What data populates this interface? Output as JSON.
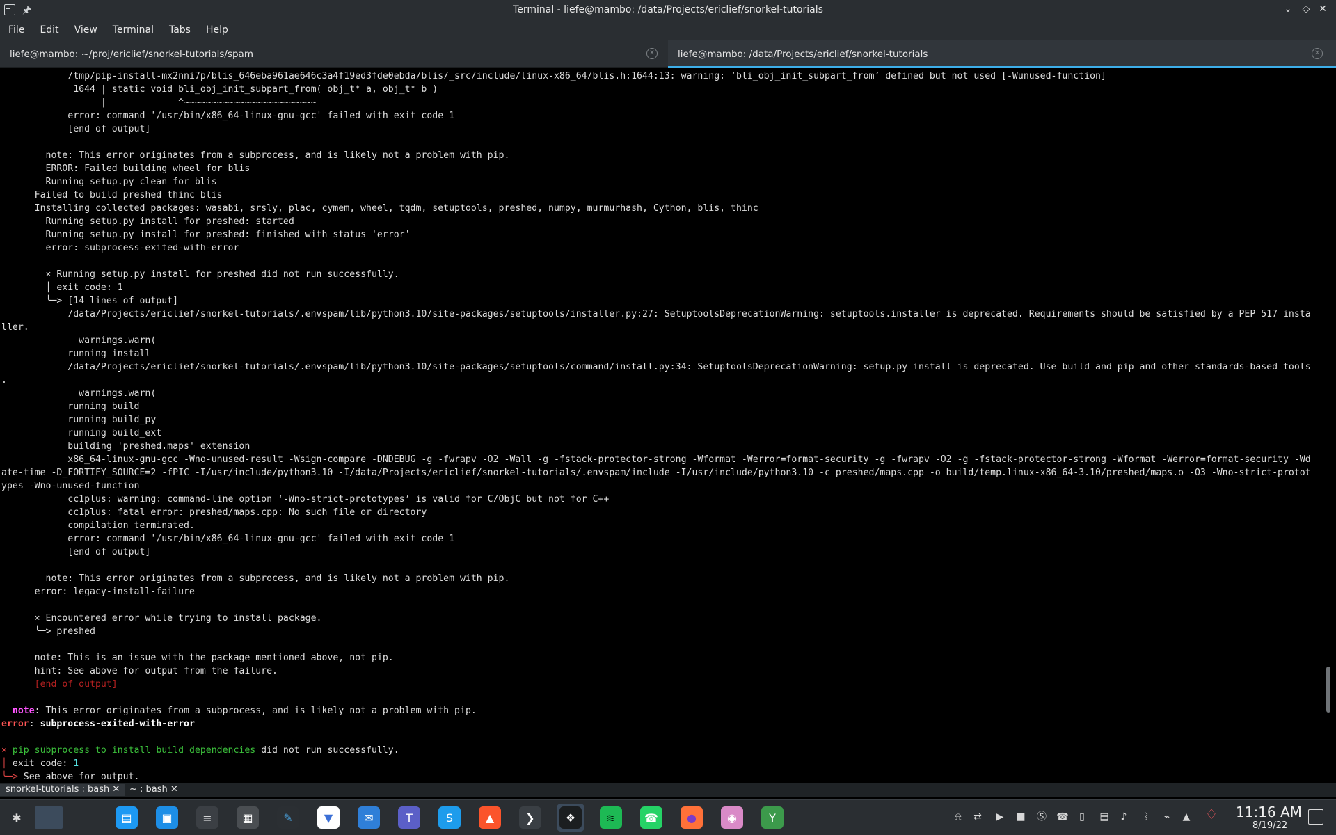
{
  "window": {
    "title": "Terminal - liefe@mambo: /data/Projects/ericlief/snorkel-tutorials",
    "controls": {
      "minimize": "⌄",
      "maximize": "◇",
      "close": "✕"
    }
  },
  "menu": [
    "File",
    "Edit",
    "View",
    "Terminal",
    "Tabs",
    "Help"
  ],
  "tabs": [
    {
      "label": "liefe@mambo: ~/proj/ericlief/snorkel-tutorials/spam",
      "active": false
    },
    {
      "label": "liefe@mambo: /data/Projects/ericlief/snorkel-tutorials",
      "active": true
    }
  ],
  "terminal": {
    "lines": [
      {
        "segments": [
          {
            "t": "            /tmp/pip-install-mx2nni7p/blis_646eba961ae646c3a4f19ed3fde0ebda/blis/_src/include/linux-x86_64/blis.h:1644:13: warning: ‘bli_obj_init_subpart_from’ defined but not used [-Wunused-function]"
          }
        ]
      },
      {
        "segments": [
          {
            "t": "             1644 | static void bli_obj_init_subpart_from( obj_t* a, obj_t* b )"
          }
        ]
      },
      {
        "segments": [
          {
            "t": "                  |             ^~~~~~~~~~~~~~~~~~~~~~~~~"
          }
        ]
      },
      {
        "segments": [
          {
            "t": "            error: command '/usr/bin/x86_64-linux-gnu-gcc' failed with exit code 1"
          }
        ]
      },
      {
        "segments": [
          {
            "t": "            [end of output]"
          }
        ]
      },
      {
        "segments": [
          {
            "t": ""
          }
        ]
      },
      {
        "segments": [
          {
            "t": "        note: This error originates from a subprocess, and is likely not a problem with pip."
          }
        ]
      },
      {
        "segments": [
          {
            "t": "        ERROR: Failed building wheel for blis"
          }
        ]
      },
      {
        "segments": [
          {
            "t": "        Running setup.py clean for blis"
          }
        ]
      },
      {
        "segments": [
          {
            "t": "      Failed to build preshed thinc blis"
          }
        ]
      },
      {
        "segments": [
          {
            "t": "      Installing collected packages: wasabi, srsly, plac, cymem, wheel, tqdm, setuptools, preshed, numpy, murmurhash, Cython, blis, thinc"
          }
        ]
      },
      {
        "segments": [
          {
            "t": "        Running setup.py install for preshed: started"
          }
        ]
      },
      {
        "segments": [
          {
            "t": "        Running setup.py install for preshed: finished with status 'error'"
          }
        ]
      },
      {
        "segments": [
          {
            "t": "        error: subprocess-exited-with-error"
          }
        ]
      },
      {
        "segments": [
          {
            "t": ""
          }
        ]
      },
      {
        "segments": [
          {
            "t": "        × Running setup.py install for preshed did not run successfully."
          }
        ]
      },
      {
        "segments": [
          {
            "t": "        │ exit code: 1"
          }
        ]
      },
      {
        "segments": [
          {
            "t": "        ╰─> [14 lines of output]"
          }
        ]
      },
      {
        "segments": [
          {
            "t": "            /data/Projects/ericlief/snorkel-tutorials/.envspam/lib/python3.10/site-packages/setuptools/installer.py:27: SetuptoolsDeprecationWarning: setuptools.installer is deprecated. Requirements should be satisfied by a PEP 517 insta"
          }
        ]
      },
      {
        "segments": [
          {
            "t": "ller."
          }
        ]
      },
      {
        "segments": [
          {
            "t": "              warnings.warn("
          }
        ]
      },
      {
        "segments": [
          {
            "t": "            running install"
          }
        ]
      },
      {
        "segments": [
          {
            "t": "            /data/Projects/ericlief/snorkel-tutorials/.envspam/lib/python3.10/site-packages/setuptools/command/install.py:34: SetuptoolsDeprecationWarning: setup.py install is deprecated. Use build and pip and other standards-based tools"
          }
        ]
      },
      {
        "segments": [
          {
            "t": "."
          }
        ]
      },
      {
        "segments": [
          {
            "t": "              warnings.warn("
          }
        ]
      },
      {
        "segments": [
          {
            "t": "            running build"
          }
        ]
      },
      {
        "segments": [
          {
            "t": "            running build_py"
          }
        ]
      },
      {
        "segments": [
          {
            "t": "            running build_ext"
          }
        ]
      },
      {
        "segments": [
          {
            "t": "            building 'preshed.maps' extension"
          }
        ]
      },
      {
        "segments": [
          {
            "t": "            x86_64-linux-gnu-gcc -Wno-unused-result -Wsign-compare -DNDEBUG -g -fwrapv -O2 -Wall -g -fstack-protector-strong -Wformat -Werror=format-security -g -fwrapv -O2 -g -fstack-protector-strong -Wformat -Werror=format-security -Wd"
          }
        ]
      },
      {
        "segments": [
          {
            "t": "ate-time -D_FORTIFY_SOURCE=2 -fPIC -I/usr/include/python3.10 -I/data/Projects/ericlief/snorkel-tutorials/.envspam/include -I/usr/include/python3.10 -c preshed/maps.cpp -o build/temp.linux-x86_64-3.10/preshed/maps.o -O3 -Wno-strict-protot"
          }
        ]
      },
      {
        "segments": [
          {
            "t": "ypes -Wno-unused-function"
          }
        ]
      },
      {
        "segments": [
          {
            "t": "            cc1plus: warning: command-line option ‘-Wno-strict-prototypes’ is valid for C/ObjC but not for C++"
          }
        ]
      },
      {
        "segments": [
          {
            "t": "            cc1plus: fatal error: preshed/maps.cpp: No such file or directory"
          }
        ]
      },
      {
        "segments": [
          {
            "t": "            compilation terminated."
          }
        ]
      },
      {
        "segments": [
          {
            "t": "            error: command '/usr/bin/x86_64-linux-gnu-gcc' failed with exit code 1"
          }
        ]
      },
      {
        "segments": [
          {
            "t": "            [end of output]"
          }
        ]
      },
      {
        "segments": [
          {
            "t": ""
          }
        ]
      },
      {
        "segments": [
          {
            "t": "        note: This error originates from a subprocess, and is likely not a problem with pip."
          }
        ]
      },
      {
        "segments": [
          {
            "t": "      error: legacy-install-failure"
          }
        ]
      },
      {
        "segments": [
          {
            "t": ""
          }
        ]
      },
      {
        "segments": [
          {
            "t": "      × Encountered error while trying to install package."
          }
        ]
      },
      {
        "segments": [
          {
            "t": "      ╰─> preshed"
          }
        ]
      },
      {
        "segments": [
          {
            "t": ""
          }
        ]
      },
      {
        "segments": [
          {
            "t": "      note: This is an issue with the package mentioned above, not pip."
          }
        ]
      },
      {
        "segments": [
          {
            "t": "      hint: See above for output from the failure."
          }
        ]
      },
      {
        "segments": [
          {
            "t": "      [end of output]",
            "c": "c-dimred"
          }
        ]
      },
      {
        "segments": [
          {
            "t": ""
          }
        ]
      },
      {
        "segments": [
          {
            "t": "  "
          },
          {
            "t": "note",
            "c": "c-magenta"
          },
          {
            "t": ": This error originates from a subprocess, and is likely not a problem with pip."
          }
        ]
      },
      {
        "segments": [
          {
            "t": "error",
            "c": "c-bred"
          },
          {
            "t": ": "
          },
          {
            "t": "subprocess-exited-with-error",
            "c": "c-bold"
          }
        ]
      },
      {
        "segments": [
          {
            "t": ""
          }
        ]
      },
      {
        "segments": [
          {
            "t": "× ",
            "c": "c-red"
          },
          {
            "t": "pip subprocess to install build dependencies",
            "c": "c-green"
          },
          {
            "t": " did not run successfully."
          }
        ]
      },
      {
        "segments": [
          {
            "t": "│ ",
            "c": "c-red"
          },
          {
            "t": "exit code: "
          },
          {
            "t": "1",
            "c": "c-cyan"
          }
        ]
      },
      {
        "segments": [
          {
            "t": "╰─>",
            "c": "c-red"
          },
          {
            "t": " See above for output."
          }
        ]
      }
    ]
  },
  "sessions": [
    {
      "label": "snorkel-tutorials : bash",
      "close": "✕"
    },
    {
      "label": "~ : bash",
      "close": "✕"
    }
  ],
  "taskbar": {
    "apps": [
      {
        "name": "application-launcher-icon",
        "glyph": "✱",
        "bg": "transparent",
        "color": "#d8d8d8"
      },
      {
        "name": "workspace-pager-icon",
        "glyph": "",
        "bg": "#3c4b5c",
        "color": "#fff"
      },
      {
        "name": "file-manager-icon",
        "glyph": "▤",
        "bg": "#1d99f3",
        "color": "#fff"
      },
      {
        "name": "app-store-icon",
        "glyph": "▣",
        "bg": "#1d8ee6",
        "color": "#fff"
      },
      {
        "name": "settings-sliders-icon",
        "glyph": "≡",
        "bg": "#3b3f44",
        "color": "#fff"
      },
      {
        "name": "calculator-icon",
        "glyph": "▦",
        "bg": "#4a4e52",
        "color": "#fff"
      },
      {
        "name": "text-editor-icon",
        "glyph": "✎",
        "bg": "#2b2f33",
        "color": "#4aa3df"
      },
      {
        "name": "vscode-icon",
        "glyph": "▼",
        "bg": "#ffffff",
        "color": "#3b6fd6"
      },
      {
        "name": "mail-client-icon",
        "glyph": "✉",
        "bg": "#2f7fd8",
        "color": "#fff"
      },
      {
        "name": "teams-icon",
        "glyph": "T",
        "bg": "#5b5fc7",
        "color": "#fff"
      },
      {
        "name": "skype-icon",
        "glyph": "S",
        "bg": "#1d9cec",
        "color": "#fff"
      },
      {
        "name": "brave-browser-icon",
        "glyph": "▲",
        "bg": "#fb542b",
        "color": "#fff"
      },
      {
        "name": "code-terminal-icon",
        "glyph": "❯",
        "bg": "#3a3f44",
        "color": "#fff"
      },
      {
        "name": "terminal-icon",
        "glyph": "❖",
        "bg": "#1b1e20",
        "color": "#fff"
      },
      {
        "name": "spotify-icon",
        "glyph": "≋",
        "bg": "#1db954",
        "color": "#000"
      },
      {
        "name": "whatsapp-icon",
        "glyph": "☎",
        "bg": "#25d366",
        "color": "#fff"
      },
      {
        "name": "firefox-icon",
        "glyph": "●",
        "bg": "#ff7139",
        "color": "#7a3cc8"
      },
      {
        "name": "chat-bubble-icon",
        "glyph": "◉",
        "bg": "#d98ac7",
        "color": "#fff"
      },
      {
        "name": "yakuake-icon",
        "glyph": "Y",
        "bg": "#3c9a4b",
        "color": "#fff"
      }
    ],
    "tray": [
      {
        "name": "notifications-bell-icon",
        "glyph": "⍾"
      },
      {
        "name": "clipboard-sync-icon",
        "glyph": "⇄"
      },
      {
        "name": "media-player-icon",
        "glyph": "▶"
      },
      {
        "name": "teams-tray-icon",
        "glyph": "■"
      },
      {
        "name": "skype-tray-icon",
        "glyph": "Ⓢ"
      },
      {
        "name": "whatsapp-tray-icon",
        "glyph": "☎"
      },
      {
        "name": "clipboard-icon",
        "glyph": "▯"
      },
      {
        "name": "message-icon",
        "glyph": "▤"
      },
      {
        "name": "volume-icon",
        "glyph": "♪"
      },
      {
        "name": "bluetooth-icon",
        "glyph": "ᛒ"
      },
      {
        "name": "network-wifi-icon",
        "glyph": "⌁"
      },
      {
        "name": "expand-tray-icon",
        "glyph": "▲"
      },
      {
        "name": "airbnb-icon",
        "glyph": "♢"
      }
    ],
    "time": "11:16 AM",
    "date": "8/19/22"
  }
}
